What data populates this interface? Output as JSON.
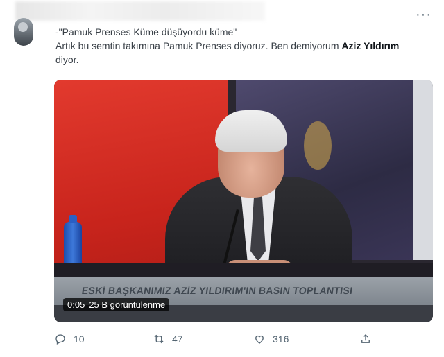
{
  "tweet": {
    "line1": "-\"Pamuk Prenses Küme düşüyordu küme\"",
    "line2_prefix": "Artık bu semtin takımına Pamuk Prenses diyoruz. Ben demiyorum ",
    "line2_bold": "Aziz Yıldırım",
    "line2_suffix": " diyor."
  },
  "video": {
    "caption": "ESKİ BAŞKANIMIZ AZİZ YILDIRIM'IN BASIN TOPLANTISI",
    "time": "0:05",
    "views": "25 B görüntülenme"
  },
  "actions": {
    "replies": "10",
    "retweets": "47",
    "likes": "316"
  },
  "icons": [
    "more-icon",
    "reply-icon",
    "retweet-icon",
    "like-icon",
    "share-icon"
  ]
}
